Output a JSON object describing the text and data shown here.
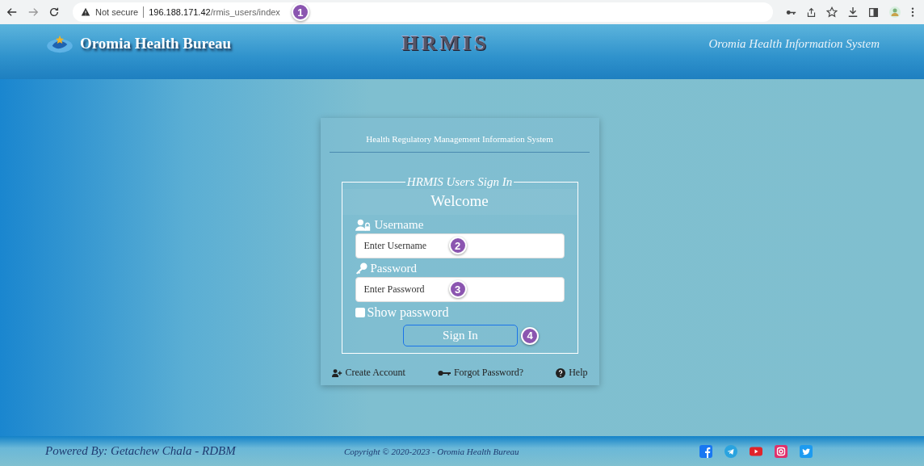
{
  "browser": {
    "security": "Not secure",
    "url_host": "196.188.171.42",
    "url_path": "/rmis_users/index",
    "callout": "1"
  },
  "header": {
    "brand": "Oromia Health Bureau",
    "logo_text": "HRMIS",
    "tagline": "Oromia Health Information System"
  },
  "card": {
    "title": "Health Regulatory Management Information System",
    "legend": "HRMIS Users Sign In",
    "welcome": "Welcome",
    "fields": [
      {
        "kind": "username",
        "label": "Username",
        "placeholder": "Enter Username",
        "callout": "2"
      },
      {
        "kind": "password",
        "label": "Password",
        "placeholder": "Enter Password",
        "callout": "3"
      }
    ],
    "show_password": {
      "label": "Show password",
      "checked": false
    },
    "button": {
      "label": "Sign In",
      "callout": "4"
    },
    "links": [
      {
        "kind": "create",
        "label": "Create Account"
      },
      {
        "kind": "forgot",
        "label": "Forgot Password?"
      },
      {
        "kind": "help",
        "label": "Help"
      }
    ]
  },
  "footer": {
    "powered": "Powered By: Getachew Chala - RDBM",
    "copyright": "Copyright © 2020-2023 - Oromia Health Bureau",
    "social": [
      {
        "kind": "facebook",
        "color": "#1877f2"
      },
      {
        "kind": "telegram",
        "color": "#2aa3df"
      },
      {
        "kind": "youtube",
        "color": "#e0242a"
      },
      {
        "kind": "instagram",
        "color": "#e1306c"
      },
      {
        "kind": "twitter",
        "color": "#1d9bf0"
      }
    ]
  }
}
